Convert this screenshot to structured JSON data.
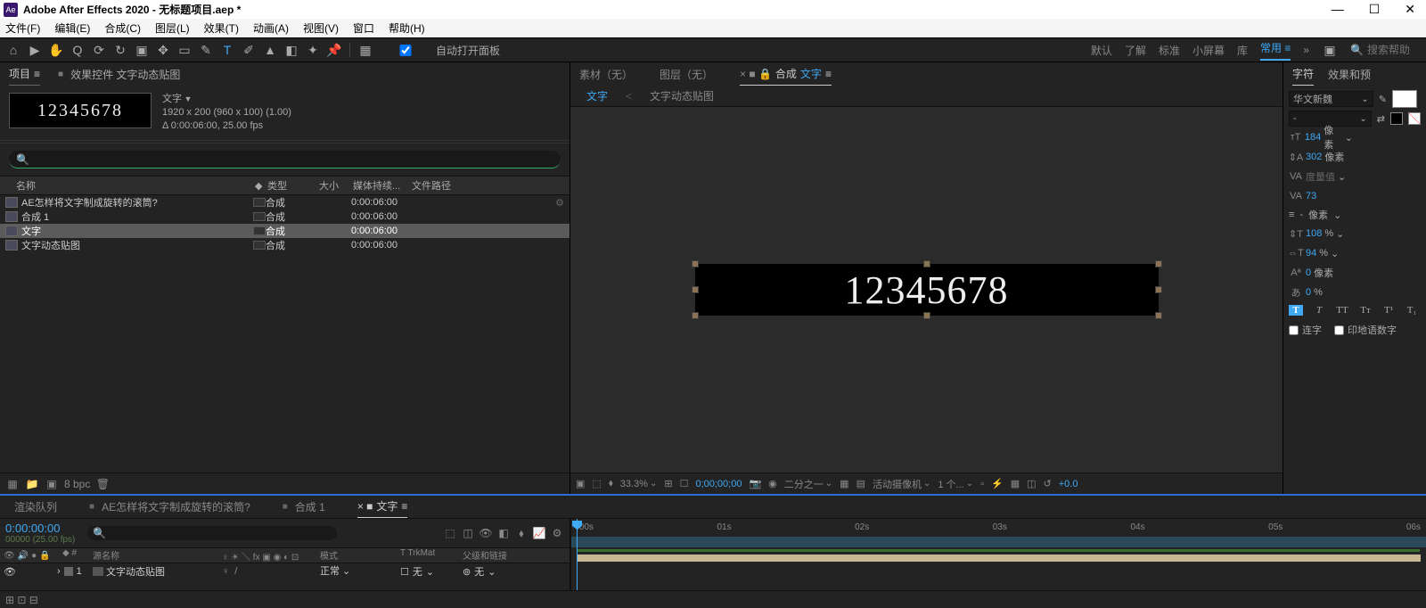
{
  "app": {
    "title": "Adobe After Effects 2020 - 无标题项目.aep *",
    "menu": [
      "文件(F)",
      "编辑(E)",
      "合成(C)",
      "图层(L)",
      "效果(T)",
      "动画(A)",
      "视图(V)",
      "窗口",
      "帮助(H)"
    ],
    "autoOpen": "自动打开面板",
    "workspaces": [
      "默认",
      "了解",
      "标准",
      "小屏幕",
      "库",
      "常用"
    ],
    "searchPlaceholder": "搜索帮助"
  },
  "project": {
    "tabProject": "项目",
    "tabFx": "效果控件 文字动态贴图",
    "thumbText": "12345678",
    "compName": "文字",
    "dims": "1920 x 200  (960 x 100) (1.00)",
    "dur": "Δ 0:00:06:00, 25.00 fps",
    "cols": {
      "name": "名称",
      "type": "类型",
      "size": "大小",
      "media": "媒体持续...",
      "path": "文件路径"
    },
    "rows": [
      {
        "name": "AE怎样将文字制成旋转的滚筒?",
        "type": "合成",
        "media": "0:00:06:00"
      },
      {
        "name": "合成 1",
        "type": "合成",
        "media": "0:00:06:00"
      },
      {
        "name": "文字",
        "type": "合成",
        "media": "0:00:06:00",
        "sel": true
      },
      {
        "name": "文字动态贴图",
        "type": "合成",
        "media": "0:00:06:00"
      }
    ],
    "bpc": "8 bpc"
  },
  "comp": {
    "tabs": {
      "footage": "素材（无）",
      "layer": "图层（无）",
      "comp": "合成",
      "compName": "文字"
    },
    "subTabs": {
      "active": "文字",
      "other": "文字动态贴图"
    },
    "canvasText": "12345678",
    "footer": {
      "zoom": "33.3%",
      "time": "0;00;00;00",
      "res": "二分之一",
      "camera": "活动摄像机",
      "views": "1 个...",
      "exposure": "+0.0"
    }
  },
  "char": {
    "tabChar": "字符",
    "tabFx": "效果和预",
    "font": "华文新魏",
    "style": "-",
    "size": "184",
    "sizeUnit": "像素",
    "leading": "302",
    "leadingUnit": "像素",
    "tracking": "度量值",
    "kerning": "73",
    "strokeUnit": "像素",
    "scaleV": "108",
    "scaleVUnit": "%",
    "scaleH": "94",
    "scaleHUnit": "%",
    "baseline": "0",
    "baselineUnit": "像素",
    "tsume": "0",
    "tsumeUnit": "%",
    "ligature": "连字",
    "hindi": "印地语数字"
  },
  "timeline": {
    "tabRender": "渲染队列",
    "tab1": "AE怎样将文字制成旋转的滚筒?",
    "tab2": "合成 1",
    "tab3": "文字",
    "timecode": "0:00:00:00",
    "fps": "00000 (25.00 fps)",
    "ruler": [
      ":00s",
      "01s",
      "02s",
      "03s",
      "04s",
      "05s",
      "06s"
    ],
    "cols": {
      "num": "#",
      "src": "源名称",
      "mode": "模式",
      "trkmat": "T  TrkMat",
      "parent": "父级和链接"
    },
    "layer": {
      "num": "1",
      "name": "文字动态贴图",
      "mode": "正常",
      "trk": "无",
      "parent": "无"
    }
  }
}
